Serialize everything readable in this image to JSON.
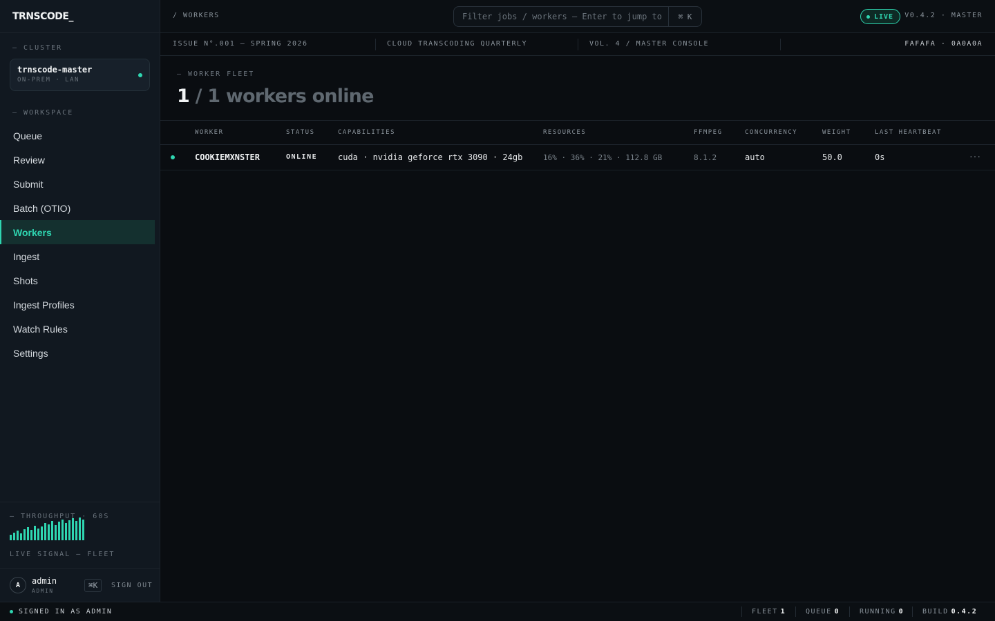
{
  "app": {
    "logo": "TRNSCODE_"
  },
  "sidebar": {
    "cluster_label": "— CLUSTER",
    "cluster": {
      "name": "trnscode-master",
      "sub": "ON-PREM · LAN"
    },
    "workspace_label": "— WORKSPACE",
    "items": [
      {
        "label": "Queue"
      },
      {
        "label": "Review"
      },
      {
        "label": "Submit"
      },
      {
        "label": "Batch (OTIO)"
      },
      {
        "label": "Workers",
        "active": true
      },
      {
        "label": "Ingest"
      },
      {
        "label": "Shots"
      },
      {
        "label": "Ingest Profiles"
      },
      {
        "label": "Watch Rules"
      },
      {
        "label": "Settings"
      }
    ],
    "throughput_label": "— THROUGHPUT · 60S",
    "throughput_values": [
      8,
      11,
      14,
      10,
      16,
      20,
      15,
      22,
      18,
      21,
      26,
      24,
      29,
      23,
      28,
      31,
      26,
      30,
      33,
      29,
      34,
      31
    ],
    "live_signal": "LIVE SIGNAL — FLEET",
    "user": {
      "avatar": "A",
      "name": "admin",
      "role": "ADMIN",
      "shortcut": "⌘K",
      "signout": "SIGN OUT"
    }
  },
  "topbar": {
    "breadcrumb": "/ WORKERS",
    "search_placeholder": "Filter jobs / workers — Enter to jump to",
    "search_shortcut": "⌘ K",
    "live": "LIVE",
    "version": "V0.4.2 · MASTER"
  },
  "issuebar": {
    "issue": "ISSUE N°.001 — SPRING 2026",
    "publication": "CLOUD TRANSCODING QUARTERLY",
    "volume": "VOL. 4 / MASTER CONSOLE",
    "palette": "FAFAFA · 0A0A0A"
  },
  "header": {
    "section": "— WORKER FLEET",
    "online": "1",
    "total": "/ 1 workers online"
  },
  "table": {
    "columns": [
      "WORKER",
      "STATUS",
      "CAPABILITIES",
      "RESOURCES",
      "FFMPEG",
      "CONCURRENCY",
      "WEIGHT",
      "LAST HEARTBEAT"
    ],
    "rows": [
      {
        "worker": "COOKIEMXNSTER",
        "status": "ONLINE",
        "capabilities": "cuda · nvidia geforce rtx 3090 · 24gb",
        "resources": "16% · 36% · 21% · 112.8 GB",
        "ffmpeg": "8.1.2",
        "concurrency": "auto",
        "weight": "50.0",
        "heartbeat": "0s",
        "menu": "···"
      }
    ]
  },
  "statusbar": {
    "signed_in": "SIGNED IN AS ADMIN",
    "fleet_label": "FLEET",
    "fleet": "1",
    "queue_label": "QUEUE",
    "queue": "0",
    "running_label": "RUNNING",
    "running": "0",
    "build_label": "BUILD",
    "build": "0.4.2"
  },
  "colors": {
    "accent": "#2fd6b1",
    "background": "#0a0d11",
    "sidebar": "#111820"
  }
}
